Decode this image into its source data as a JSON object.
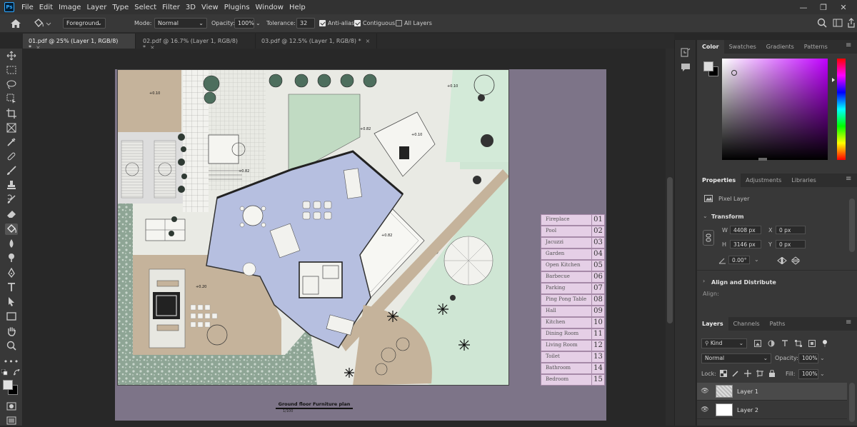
{
  "app": {
    "logo": "Ps",
    "accent": "#31a8ff"
  },
  "menu": [
    "File",
    "Edit",
    "Image",
    "Layer",
    "Type",
    "Select",
    "Filter",
    "3D",
    "View",
    "Plugins",
    "Window",
    "Help"
  ],
  "options": {
    "source": "Foreground",
    "mode_label": "Mode:",
    "mode_value": "Normal",
    "opacity_label": "Opacity:",
    "opacity_value": "100%",
    "tolerance_label": "Tolerance:",
    "tolerance_value": "32",
    "antialias": "Anti-alias",
    "contiguous": "Contiguous",
    "all_layers": "All Layers"
  },
  "tabs": [
    {
      "label": "01.pdf @ 25% (Layer 1, RGB/8) *"
    },
    {
      "label": "02.pdf @ 16.7% (Layer 1, RGB/8) *"
    },
    {
      "label": "03.pdf @ 12.5% (Layer 1, RGB/8) *"
    }
  ],
  "tools": [
    "move-tool",
    "marquee-tool",
    "lasso-tool",
    "object-select-tool",
    "crop-tool",
    "frame-tool",
    "eyedropper-tool",
    "healing-tool",
    "brush-tool",
    "stamp-tool",
    "history-brush-tool",
    "eraser-tool",
    "paint-bucket-tool",
    "blur-tool",
    "dodge-tool",
    "pen-tool",
    "type-tool",
    "path-select-tool",
    "rectangle-tool",
    "hand-tool",
    "zoom-tool",
    "more-tools"
  ],
  "plan": {
    "legend": [
      {
        "name": "Fireplace",
        "num": "01"
      },
      {
        "name": "Pool",
        "num": "02"
      },
      {
        "name": "Jacuzzi",
        "num": "03"
      },
      {
        "name": "Garden",
        "num": "04"
      },
      {
        "name": "Open Kitchen",
        "num": "05"
      },
      {
        "name": "Barbecue",
        "num": "06"
      },
      {
        "name": "Parking",
        "num": "07"
      },
      {
        "name": "Ping Pong Table",
        "num": "08"
      },
      {
        "name": "Hall",
        "num": "09"
      },
      {
        "name": "Kitchen",
        "num": "10"
      },
      {
        "name": "Dining Room",
        "num": "11"
      },
      {
        "name": "Living Room",
        "num": "12"
      },
      {
        "name": "Toilet",
        "num": "13"
      },
      {
        "name": "Bathroom",
        "num": "14"
      },
      {
        "name": "Bedroom",
        "num": "15"
      }
    ],
    "caption": "Ground floor Furniture plan",
    "caption_scale": "1/100",
    "levels": [
      "+0.10",
      "+0.82",
      "+0.10",
      "+0.82",
      "+0.82",
      "+0.10",
      "+0.20"
    ]
  },
  "color_panel": {
    "tabs": [
      "Color",
      "Swatches",
      "Gradients",
      "Patterns"
    ]
  },
  "properties": {
    "tabs": [
      "Properties",
      "Adjustments",
      "Libraries"
    ],
    "layer_type": "Pixel Layer",
    "transform": "Transform",
    "w_label": "W",
    "w": "4408 px",
    "h_label": "H",
    "h": "3146 px",
    "x_label": "X",
    "x": "0 px",
    "y_label": "Y",
    "y": "0 px",
    "angle": "0.00°",
    "align": "Align and Distribute",
    "align_label": "Align:"
  },
  "layers": {
    "tabs": [
      "Layers",
      "Channels",
      "Paths"
    ],
    "filter": "Kind",
    "blend": "Normal",
    "opacity_label": "Opacity:",
    "opacity": "100%",
    "lock_label": "Lock:",
    "fill_label": "Fill:",
    "fill": "100%",
    "items": [
      {
        "name": "Layer 1"
      },
      {
        "name": "Layer 2"
      }
    ]
  }
}
